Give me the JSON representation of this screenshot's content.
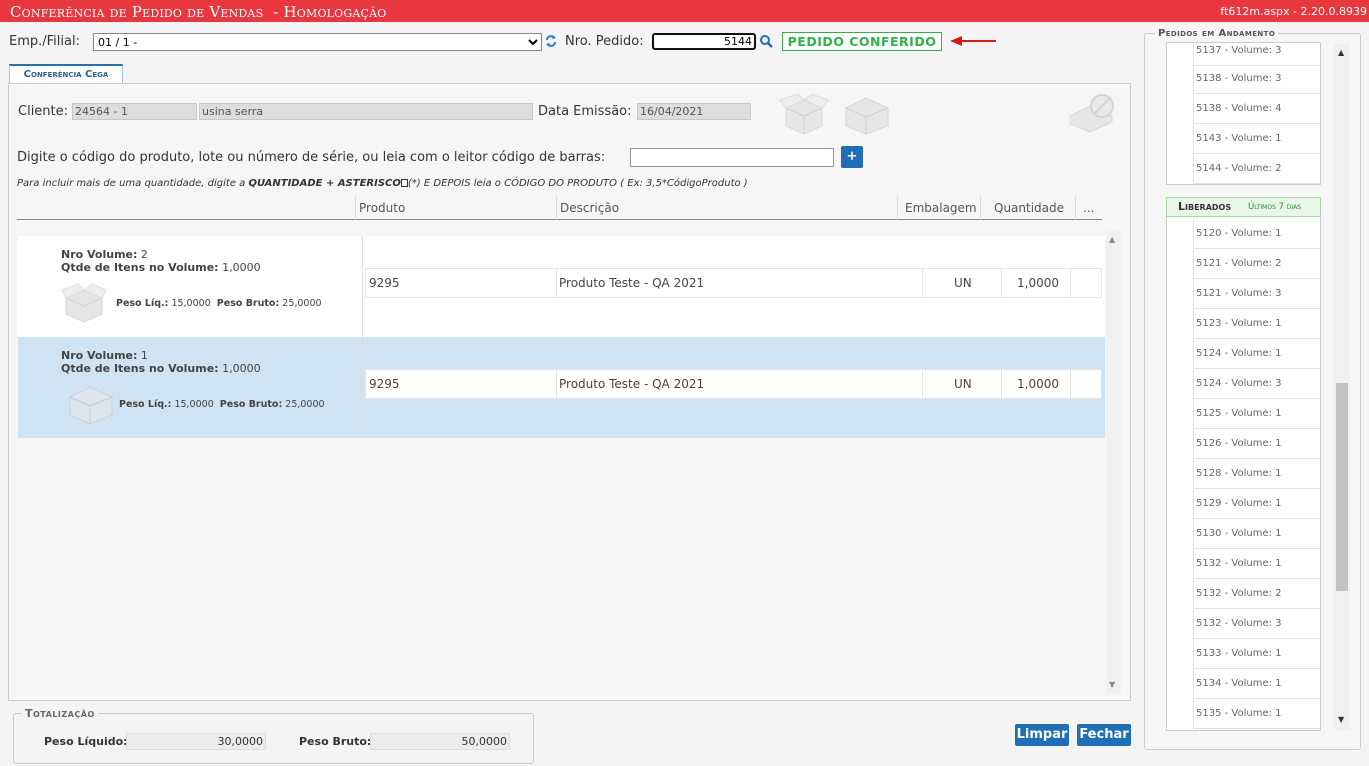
{
  "window": {
    "title": "Conferência de Pedido de Vendas",
    "env": "- Homologação",
    "version": "ft612m.aspx - 2.20.0.8939"
  },
  "header": {
    "filial_label": "Emp./Filial:",
    "filial_value": "01 / 1 -",
    "pedido_label": "Nro. Pedido:",
    "pedido_value": "5144",
    "status": "PEDIDO CONFERIDO"
  },
  "tab": {
    "label": "Conferência Cega"
  },
  "client": {
    "label": "Cliente:",
    "code": "24564 - 1",
    "name": "usina serra",
    "date_label": "Data Emissão:",
    "date": "16/04/2021"
  },
  "scan": {
    "label": "Digite o código do produto, lote ou número de série, ou leia com o leitor código de barras:",
    "value": "",
    "add": "+"
  },
  "hint": {
    "p1": "Para incluir mais de uma quantidade, digite a ",
    "b1": "QUANTIDADE + ASTERISCO",
    "p2": "(*)",
    "p3": " E DEPOIS leia o CÓDIGO DO PRODUTO ( Ex: 3,5*CódigoProduto )"
  },
  "grid": {
    "columns": [
      "Produto",
      "Descrição",
      "Embalagem",
      "Quantidade",
      "..."
    ]
  },
  "volumes": [
    {
      "nro_label": "Nro Volume:",
      "nro": "2",
      "qtd_label": "Qtde de Itens no Volume:",
      "qtd": "1,0000",
      "pl_label": "Peso Líq.:",
      "pl": "15,0000",
      "pb_label": "Peso Bruto:",
      "pb": "25,0000",
      "row": {
        "produto": "9295",
        "descricao": "Produto Teste - QA 2021",
        "embalagem": "UN",
        "quantidade": "1,0000"
      }
    },
    {
      "nro_label": "Nro Volume:",
      "nro": "1",
      "qtd_label": "Qtde de Itens no Volume:",
      "qtd": "1,0000",
      "pl_label": "Peso Líq.:",
      "pl": "15,0000",
      "pb_label": "Peso Bruto:",
      "pb": "25,0000",
      "row": {
        "produto": "9295",
        "descricao": "Produto Teste - QA 2021",
        "embalagem": "UN",
        "quantidade": "1,0000"
      }
    }
  ],
  "totals": {
    "legend": "Totalização",
    "pl_label": "Peso Líquido:",
    "pl": "30,0000",
    "pb_label": "Peso Bruto:",
    "pb": "50,0000"
  },
  "buttons": {
    "limpar": "Limpar",
    "fechar": "Fechar"
  },
  "right": {
    "legend": "Pedidos em Andamento",
    "andamento": [
      "5137 - Volume: 3",
      "5138 - Volume: 3",
      "5138 - Volume: 4",
      "5143 - Volume: 1",
      "5144 - Volume: 2"
    ],
    "liberados_title": "Liberados",
    "liberados_sub": "Últimos 7 dias",
    "liberados": [
      "5120 - Volume: 1",
      "5121 - Volume: 2",
      "5121 - Volume: 3",
      "5123 - Volume: 1",
      "5124 - Volume: 1",
      "5124 - Volume: 3",
      "5125 - Volume: 1",
      "5126 - Volume: 1",
      "5128 - Volume: 1",
      "5129 - Volume: 1",
      "5130 - Volume: 1",
      "5132 - Volume: 1",
      "5132 - Volume: 2",
      "5132 - Volume: 3",
      "5133 - Volume: 1",
      "5134 - Volume: 1",
      "5135 - Volume: 1"
    ]
  },
  "colors": {
    "titlebar": "#e8373f",
    "accent": "#1f6fb8",
    "success": "#31b14a",
    "selected_row": "#cfe3f3"
  }
}
